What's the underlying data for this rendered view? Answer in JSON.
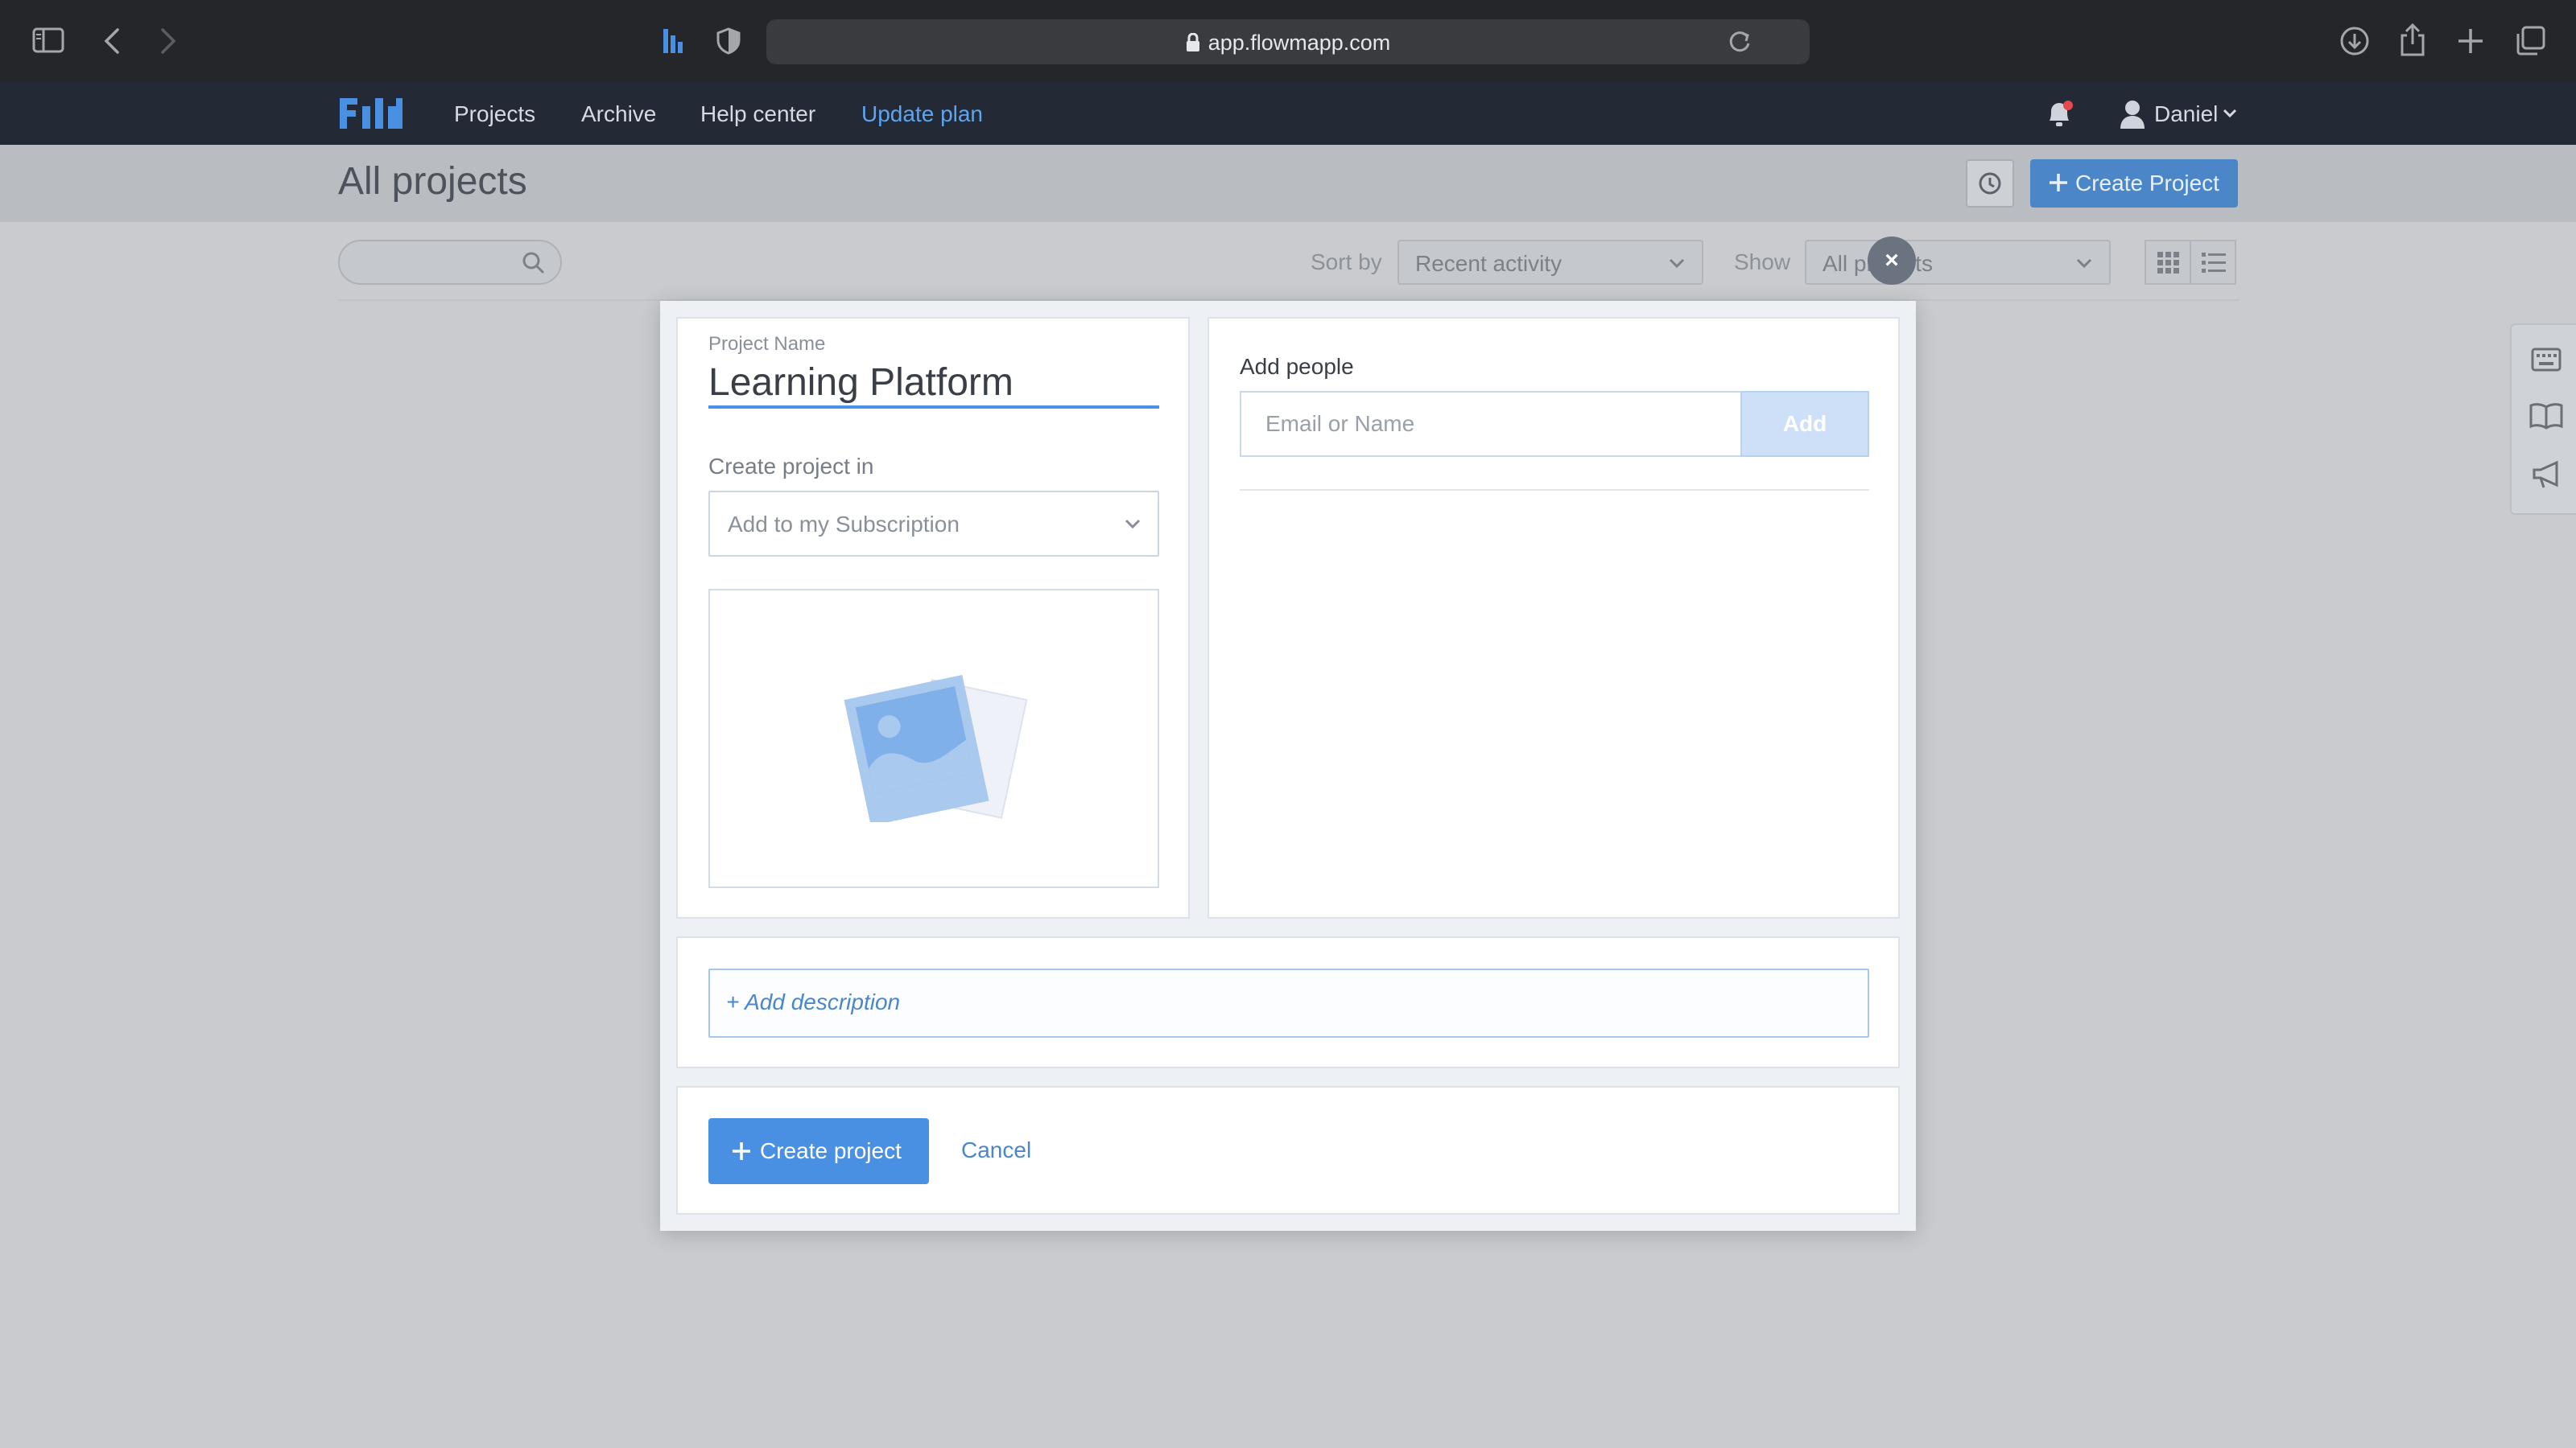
{
  "browser": {
    "url": "app.flowmapp.com"
  },
  "nav": {
    "logo": "FM",
    "links": [
      "Projects",
      "Archive",
      "Help center",
      "Update plan"
    ],
    "user": "Daniel"
  },
  "page": {
    "title": "All projects",
    "create_button": "Create Project"
  },
  "toolbar": {
    "sort_label": "Sort by",
    "sort_value": "Recent activity",
    "show_label": "Show",
    "show_value": "All projects",
    "close": "×"
  },
  "modal": {
    "project_name_label": "Project Name",
    "project_name_value": "Learning Platform",
    "create_in_label": "Create project in",
    "create_in_value": "Add to my Subscription",
    "add_people_label": "Add people",
    "email_placeholder": "Email or Name",
    "add_button": "Add",
    "add_description": "+ Add description",
    "create_button": "Create project",
    "cancel": "Cancel"
  },
  "colors": {
    "accent": "#4a90e2",
    "nav_bg": "#232a36",
    "browser_bg": "#25262a",
    "notification_dot": "#e5484d"
  },
  "icons": [
    "sidebar-icon",
    "back-icon",
    "forward-icon",
    "extension-icon",
    "shield-icon",
    "lock-icon",
    "reload-icon",
    "download-icon",
    "share-icon",
    "new-tab-icon",
    "tabs-icon",
    "bell-icon",
    "user-icon",
    "chevron-down-icon",
    "history-icon",
    "plus-icon",
    "search-icon",
    "grid-view-icon",
    "list-view-icon",
    "keyboard-icon",
    "book-icon",
    "megaphone-icon",
    "image-placeholder-icon",
    "close-icon"
  ]
}
